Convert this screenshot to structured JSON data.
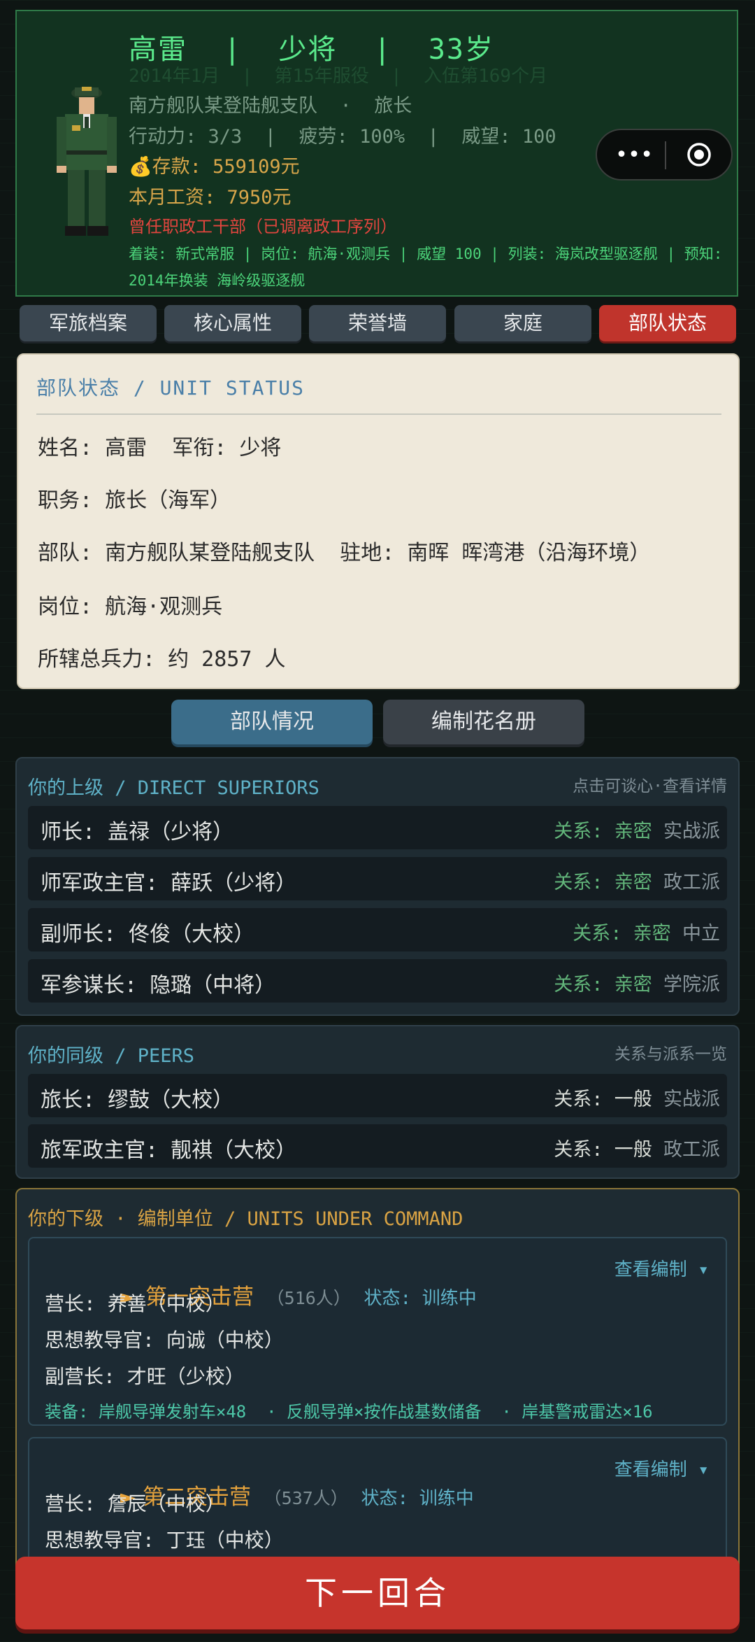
{
  "profile": {
    "name_line": "高雷  |  少将  |  33岁",
    "service_line": "2014年1月  |  第15年服役  |  入伍第169个月",
    "unit_line": "南方舰队某登陆舰支队  ·  旅长",
    "stats_line": "行动力: 3/3  |  疲劳: 100%  |  威望: 100",
    "money_icon": "💰",
    "money_line": "存款: 559109元",
    "salary_line": "本月工资: 7950元",
    "former_line": "曾任职政工干部（已调离政工序列）",
    "equip_line": "着装: 新式常服 | 岗位: 航海·观测兵 | 威望 100 | 列装: 海岚改型驱逐舰 | 预知: 2014年换装 海岭级驱逐舰"
  },
  "capsule": {
    "more": "•••"
  },
  "tabs": [
    "军旅档案",
    "核心属性",
    "荣誉墙",
    "家庭",
    "部队状态"
  ],
  "status": {
    "title": "部队状态 / UNIT STATUS",
    "rows": [
      "姓名: 高雷  军衔: 少将",
      "职务: 旅长（海军）",
      "部队: 南方舰队某登陆舰支队  驻地: 南晖 晖湾港（沿海环境）",
      "岗位: 航海·观测兵",
      "所辖总兵力: 约 2857 人"
    ]
  },
  "subtabs": {
    "situation": "部队情况",
    "roster": "编制花名册"
  },
  "superiors": {
    "title": "你的上级 / DIRECT SUPERIORS",
    "hint": "点击可谈心·查看详情",
    "rows": [
      {
        "name": "师长: 盖禄（少将）",
        "rel": "关系: 亲密",
        "faction": "实战派"
      },
      {
        "name": "师军政主官: 薛跃（少将）",
        "rel": "关系: 亲密",
        "faction": "政工派"
      },
      {
        "name": "副师长: 佟俊（大校）",
        "rel": "关系: 亲密",
        "faction": "中立"
      },
      {
        "name": "军参谋长: 隐璐（中将）",
        "rel": "关系: 亲密",
        "faction": "学院派"
      }
    ]
  },
  "peers": {
    "title": "你的同级 / PEERS",
    "hint": "关系与派系一览",
    "rows": [
      {
        "name": "旅长: 缪鼓（大校）",
        "rel": "关系: 一般",
        "faction": "实战派"
      },
      {
        "name": "旅军政主官: 靓祺（大校）",
        "rel": "关系: 一般",
        "faction": "政工派"
      }
    ]
  },
  "subordinates": {
    "title": "你的下级 · 编制单位 / UNITS UNDER COMMAND",
    "view_label": "查看编制 ▾",
    "battalions": [
      {
        "name": "第一突击营",
        "count": "（516人）",
        "state": "状态: 训练中",
        "lines": [
          "营长: 养善（中校）",
          "思想教导官: 向诚（中校）",
          "副营长: 才旺（少校）"
        ],
        "equip": "装备: 岸舰导弹发射车×48  · 反舰导弹×按作战基数储备  · 岸基警戒雷达×16"
      },
      {
        "name": "第二突击营",
        "count": "（537人）",
        "state": "状态: 训练中",
        "lines": [
          "营长: 詹辰（中校）",
          "思想教导官: 丁珏（中校）"
        ]
      }
    ]
  },
  "next_turn": "下一回合",
  "colors": {
    "accent_green": "#5bea8c",
    "active_tab": "#c0342c",
    "next_turn": "#c6342c",
    "gold": "#d8a64a"
  }
}
